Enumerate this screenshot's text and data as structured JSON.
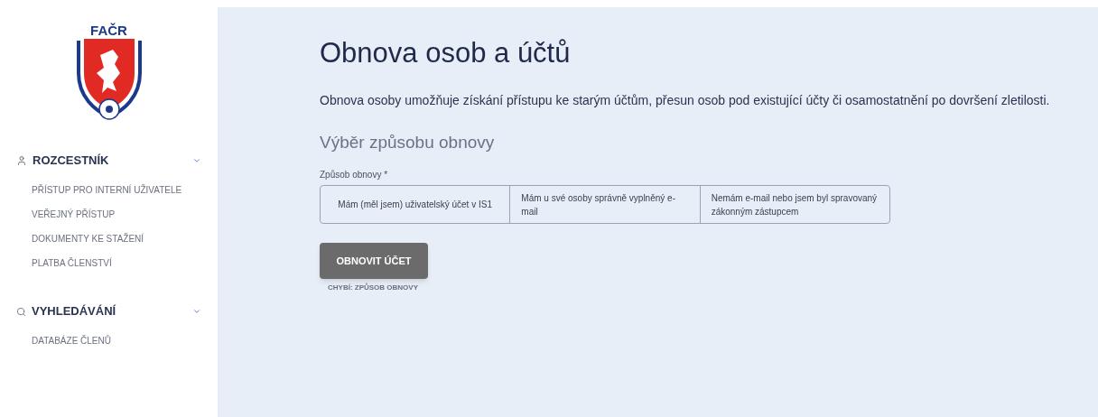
{
  "logo": {
    "text": "FAČR"
  },
  "sidebar": {
    "sections": [
      {
        "title": "ROZCESTNÍK",
        "kind": "user",
        "expanded": true,
        "items": [
          "PŘÍSTUP PRO INTERNÍ UŽIVATELE",
          "VEŘEJNÝ PŘÍSTUP",
          "DOKUMENTY KE STAŽENÍ",
          "PLATBA ČLENSTVÍ"
        ]
      },
      {
        "title": "VYHLEDÁVÁNÍ",
        "kind": "search",
        "expanded": true,
        "items": [
          "DATABÁZE ČLENŮ"
        ]
      }
    ]
  },
  "page": {
    "title": "Obnova osob a účtů",
    "intro": "Obnova osoby umožňuje získání přístupu ke starým účtům, přesun osob pod existující účty či osamostatnění po dovršení zletilosti.",
    "subtitle": "Výběr způsobu obnovy",
    "field": {
      "label": "Způsob obnovy *",
      "options": [
        {
          "label": "Mám (měl jsem) uživatelský účet v IS1",
          "selected": false
        },
        {
          "label": "Mám u své osoby správně vyplněný e-mail",
          "selected": false
        },
        {
          "label": "Nemám e-mail nebo jsem byl spravovaný zákonným zástupcem",
          "selected": false
        }
      ]
    },
    "button": {
      "label": "OBNOVIT ÚČET",
      "disabled": true
    },
    "error": "CHYBÍ: ZPŮSOB OBNOVY"
  }
}
